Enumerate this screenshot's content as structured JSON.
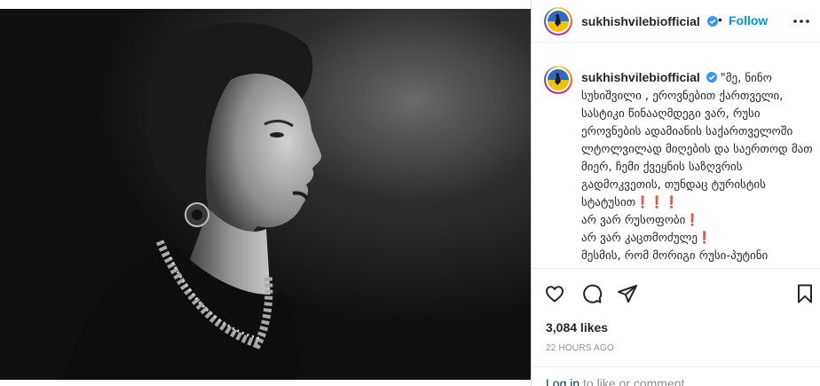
{
  "post": {
    "username": "sukhishvilebiofficial",
    "verified_icon": "verified-badge-icon",
    "separator": "•",
    "follow_label": "Follow",
    "more_icon": "more-options-icon",
    "image_alt": "Black and white portrait of a woman in profile wearing earrings and a necklace"
  },
  "comment": {
    "username": "sukhishvilebiofficial",
    "text": "\"მე, ნინო სუხიშვილი , ეროვნებით ქართველი, სასტიკი წინააღმდეგი ვარ, რუსი ეროვნების ადამიანის საქართველოში ლტოლვილად მიღების და საერთოდ მათ მიერ, ჩემი ქვეყნის საზღვრის გადმოკვეთის, თუნდაც ტურისტის სტატუსით❗❗❗\nარ ვარ რუსოფობი❗\nარ ვარ კაცთმოძულე❗\nმესმის, რომ მორიგი რუსი-პუტინი"
  },
  "actions": {
    "like_icon": "heart-icon",
    "comment_icon": "comment-icon",
    "share_icon": "share-icon",
    "save_icon": "bookmark-icon"
  },
  "likes_text": "3,084 likes",
  "timestamp": "22 HOURS AGO",
  "login": {
    "link_text": "Log in",
    "rest_text": " to like or comment."
  },
  "colors": {
    "accent": "#0095f6",
    "text": "#262626",
    "muted": "#8e8e8e",
    "border": "#dbdbdb"
  }
}
